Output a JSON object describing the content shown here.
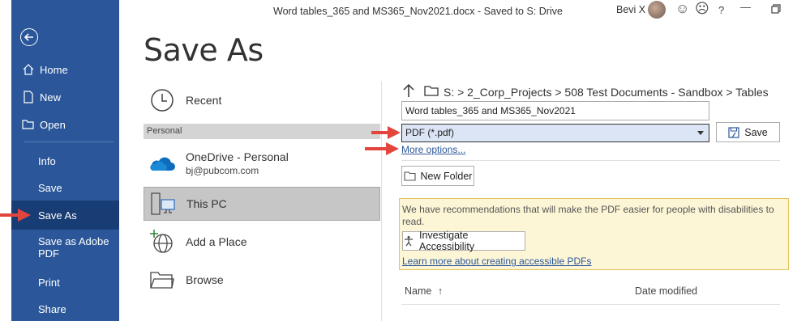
{
  "window": {
    "title": "Word tables_365 and MS365_Nov2021.docx  -  Saved to S: Drive",
    "user": "Bevi X",
    "help": "?"
  },
  "nav": {
    "items": [
      {
        "label": "Home",
        "icon": "home-icon"
      },
      {
        "label": "New",
        "icon": "new-doc-icon"
      },
      {
        "label": "Open",
        "icon": "open-folder-icon"
      },
      {
        "label": "Info"
      },
      {
        "label": "Save"
      },
      {
        "label": "Save As",
        "active": true
      },
      {
        "label": "Save as Adobe PDF"
      },
      {
        "label": "Print"
      },
      {
        "label": "Share"
      }
    ],
    "save_as_pdf_line1": "Save as Adobe",
    "save_as_pdf_line2": "PDF"
  },
  "page": {
    "heading": "Save As"
  },
  "locations": {
    "recent": "Recent",
    "personal_header": "Personal",
    "onedrive_name": "OneDrive - Personal",
    "onedrive_email": "bj@pubcom.com",
    "this_pc": "This PC",
    "add_place": "Add a Place",
    "browse": "Browse"
  },
  "save_pane": {
    "breadcrumb": "S: > 2_Corp_Projects > 508 Test Documents - Sandbox > Tables",
    "filename": "Word tables_365 and MS365_Nov2021",
    "filetype": "PDF (*.pdf)",
    "save_label": "Save",
    "more_options": "More options...",
    "new_folder": "New Folder",
    "notice_text": "We have recommendations that will make the PDF easier for people with disabilities to read.",
    "investigate_label": "Investigate Accessibility",
    "learn_more": "Learn more about creating accessible PDFs",
    "col_name": "Name",
    "col_date": "Date modified"
  },
  "colors": {
    "nav_bg": "#2b579a",
    "nav_active": "#173d74",
    "accent_link": "#2b579a",
    "arrow_red": "#e2453c",
    "notice_bg": "#fdf6d6"
  }
}
